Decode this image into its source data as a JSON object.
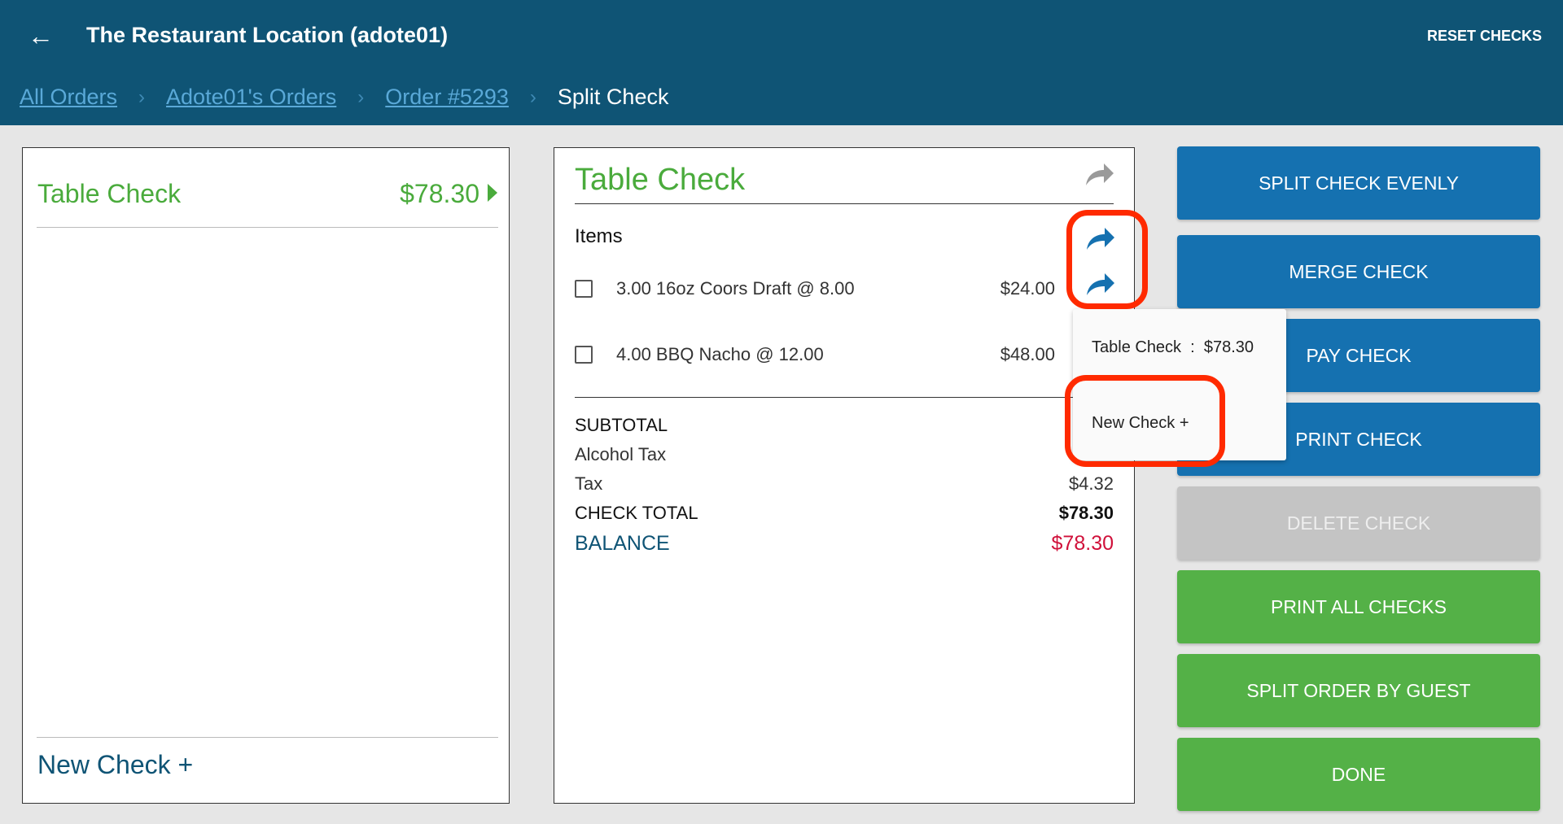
{
  "header": {
    "title": "The Restaurant Location (adote01)",
    "reset_label": "RESET CHECKS",
    "back_icon": "arrow-left-icon"
  },
  "breadcrumb": {
    "items": [
      "All Orders",
      "Adote01's Orders",
      "Order #5293"
    ],
    "current": "Split Check",
    "separator": "›"
  },
  "checks_list": {
    "checks": [
      {
        "name": "Table Check",
        "amount": "$78.30"
      }
    ],
    "new_check_label": "New Check +"
  },
  "check_detail": {
    "title": "Table Check",
    "items_label": "Items",
    "items": [
      {
        "desc": "3.00 16oz Coors Draft @  8.00",
        "price": "$24.00"
      },
      {
        "desc": "4.00 BBQ Nacho @  12.00",
        "price": "$48.00"
      }
    ],
    "subtotal_label": "SUBTOTAL",
    "alcohol_tax_label": "Alcohol Tax",
    "tax_label": "Tax",
    "tax_value": "$4.32",
    "check_total_label": "CHECK TOTAL",
    "check_total_value": "$78.30",
    "balance_label": "BALANCE",
    "balance_value": "$78.30"
  },
  "move_menu": {
    "items": [
      "Table Check  :  $78.30",
      "New Check +"
    ]
  },
  "actions": [
    "SPLIT CHECK EVENLY",
    "MERGE CHECK",
    "PAY CHECK",
    "PRINT CHECK",
    "DELETE CHECK",
    "PRINT ALL CHECKS",
    "SPLIT ORDER BY GUEST",
    "DONE"
  ],
  "colors": {
    "header": "#0f5475",
    "accent_green": "#4aab3c",
    "button_blue": "#1571b0",
    "button_green": "#54b147",
    "balance_red": "#d0103a",
    "highlight": "#ff2a00"
  }
}
